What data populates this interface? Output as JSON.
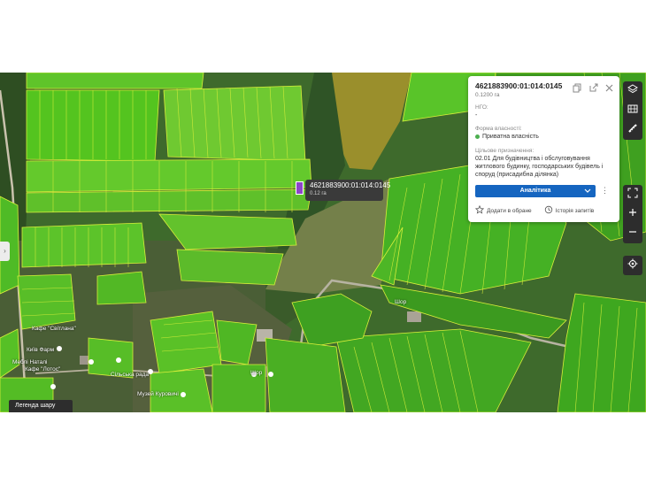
{
  "map": {
    "tooltip": {
      "cadastral": "4621883900:01:014:0145",
      "area": "0.12 га"
    },
    "places": [
      {
        "id": "p1",
        "label": "Київ Фарм"
      },
      {
        "id": "p2",
        "label": "Меблі Наталі"
      },
      {
        "id": "p3",
        "label": "Кафе \"Лотос\""
      },
      {
        "id": "p4",
        "label": "Сільська рада"
      },
      {
        "id": "p5",
        "label": "Музей Куровичі"
      },
      {
        "id": "p6",
        "label": "Кафе \"Світлана\""
      },
      {
        "id": "p7",
        "label": "Шор"
      },
      {
        "id": "p8",
        "label": "Шор"
      }
    ]
  },
  "panel": {
    "title": "4621883900:01:014:0145",
    "area": "0.1200 га",
    "ngo_label": "НГО:",
    "ngo_value": "-",
    "ownership_label": "Форма власності:",
    "ownership_value": "Приватна власність",
    "purpose_label": "Цільове призначення:",
    "purpose_value": "02.01 Для будівництва і обслуговування житлового будинку, господарських будівель і споруд (присадибна ділянка)",
    "analytics_button": "Аналітика",
    "favorite_label": "Додати в обране",
    "history_label": "Історія запитів",
    "status_color": "#4caf50",
    "accent_color": "#1565c0"
  },
  "legend_button": "Легенда шару"
}
